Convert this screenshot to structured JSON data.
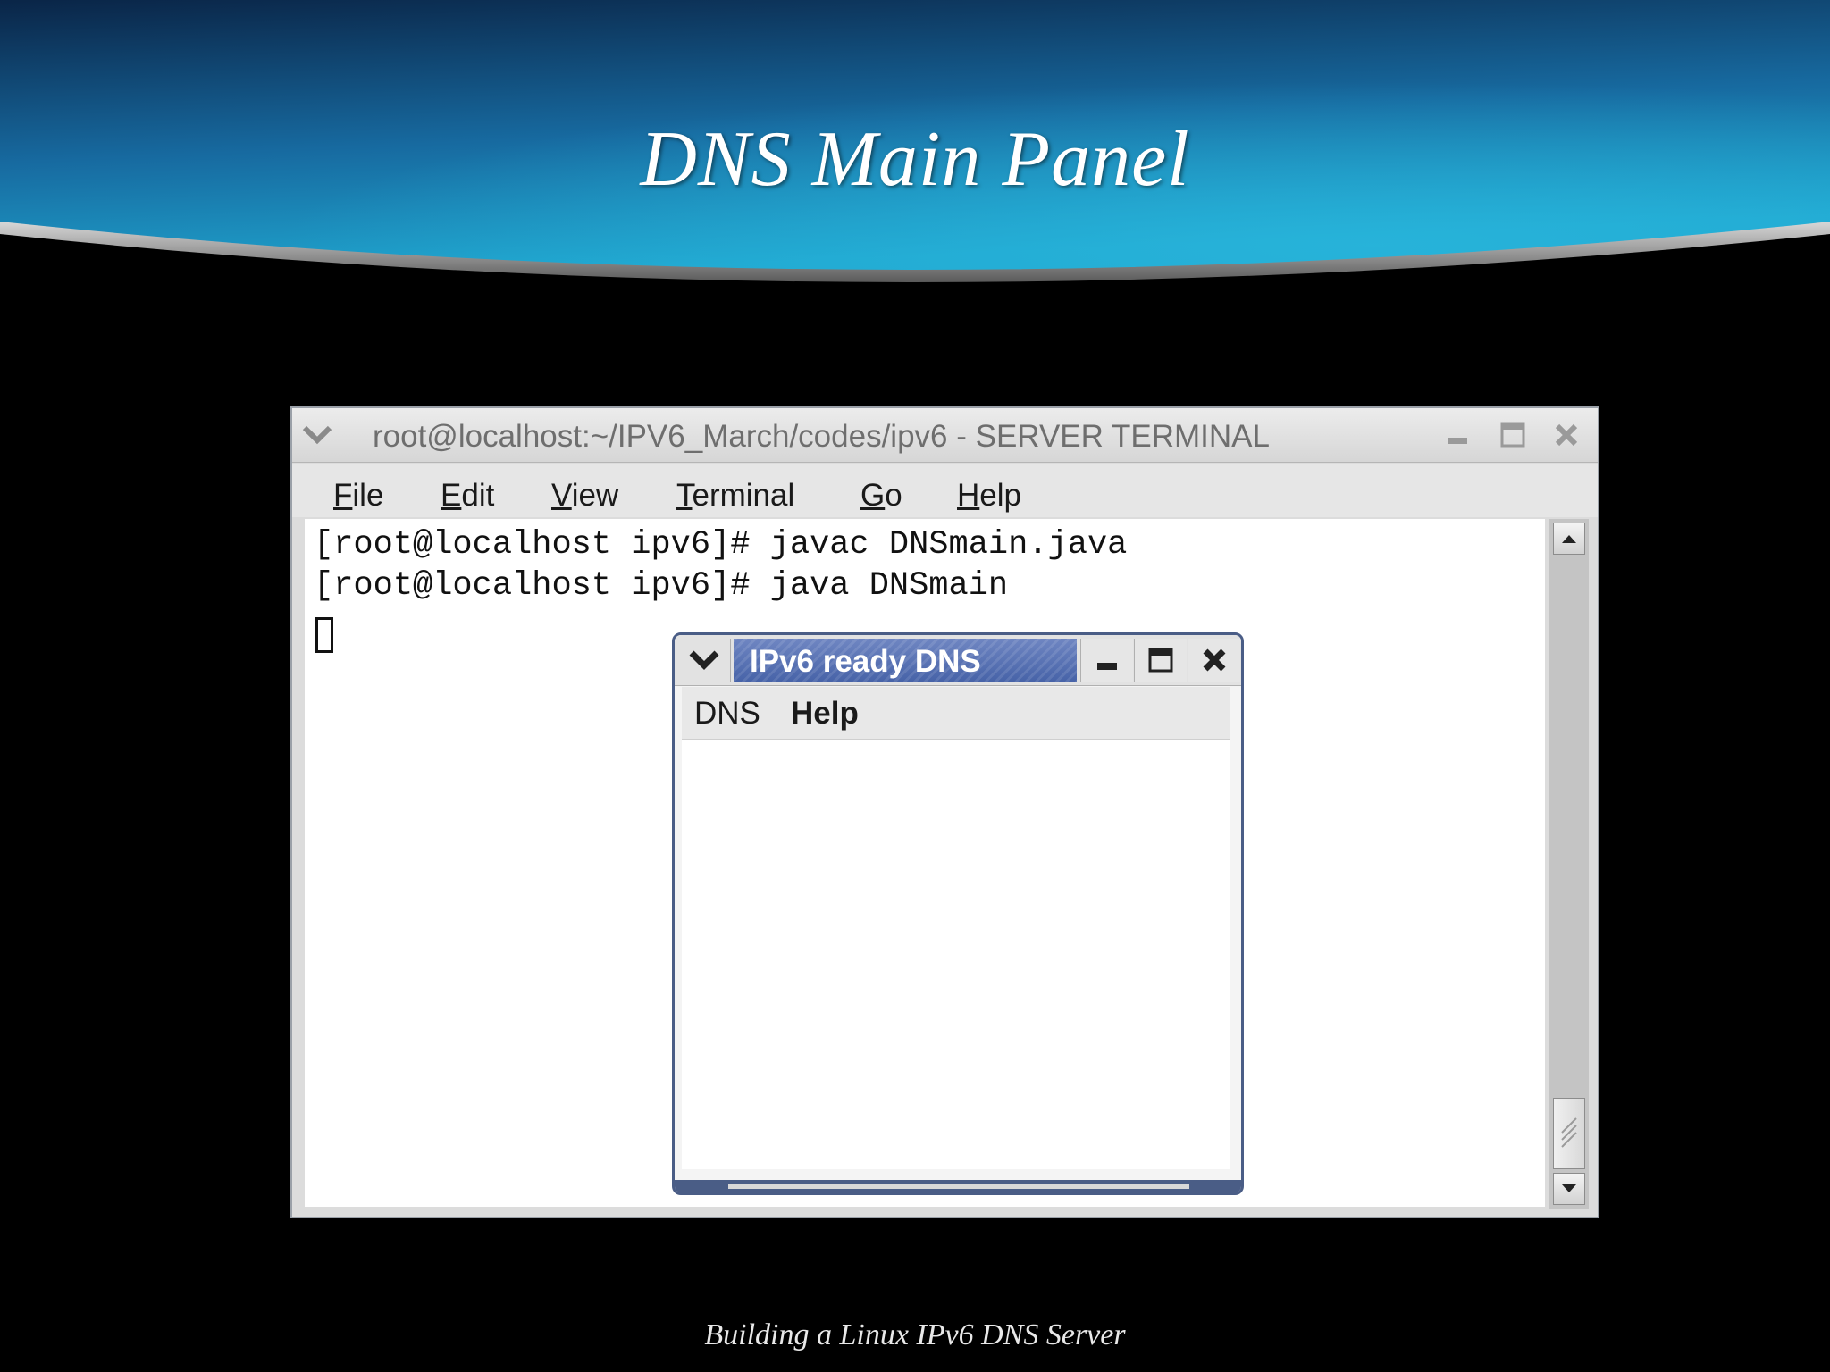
{
  "slide": {
    "title": "DNS Main Panel",
    "footer": "Building a Linux IPv6 DNS Server"
  },
  "terminal": {
    "title": "root@localhost:~/IPV6_March/codes/ipv6 - SERVER TERMINAL",
    "menu": [
      {
        "mnemonic": "F",
        "rest": "ile"
      },
      {
        "mnemonic": "E",
        "rest": "dit"
      },
      {
        "mnemonic": "V",
        "rest": "iew"
      },
      {
        "mnemonic": "T",
        "rest": "erminal"
      },
      {
        "mnemonic": "G",
        "rest": "o"
      },
      {
        "mnemonic": "H",
        "rest": "elp"
      }
    ],
    "lines": [
      "[root@localhost ipv6]# javac DNSmain.java",
      "[root@localhost ipv6]# java DNSmain"
    ]
  },
  "dns_window": {
    "title": "IPv6 ready DNS",
    "menu": [
      "DNS",
      "Help"
    ]
  },
  "colors": {
    "banner_dark": "#0b2a52",
    "banner_light": "#1b9cc4",
    "dialog_accent": "#4a63a8"
  }
}
